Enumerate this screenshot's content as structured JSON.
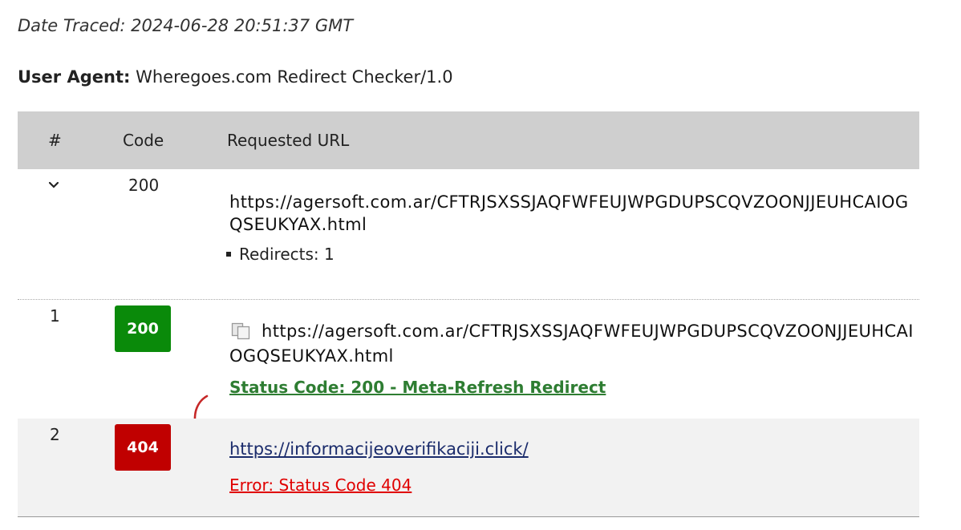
{
  "date_traced": "Date Traced: 2024-06-28 20:51:37 GMT",
  "user_agent": {
    "label": "User Agent:",
    "value": "Wheregoes.com Redirect Checker/1.0"
  },
  "table": {
    "headers": {
      "num": "#",
      "code": "Code",
      "url": "Requested URL"
    }
  },
  "summary": {
    "chevron": "⌄",
    "code": "200",
    "url": "https://agersoft.com.ar/CFTRJSXSSJAQFWFEUJWPGDUPSCQVZOONJJEUHCAIOGQSEUKYAX.html",
    "redirects": "Redirects: 1"
  },
  "rows": [
    {
      "index": "1",
      "code": "200",
      "url": "https://agersoft.com.ar/CFTRJSXSSJAQFWFEUJWPGDUPSCQVZOONJJEUHCAIOGQSEUKYAX.html",
      "status": "Status Code: 200 - Meta-Refresh Redirect",
      "badge_color": "#0a8a0a"
    },
    {
      "index": "2",
      "code": "404",
      "url": "https://informacijeoverifikaciji.click/",
      "status": "Error: Status Code 404",
      "badge_color": "#c00000"
    }
  ],
  "icons": {
    "copy": "copy-icon",
    "chevron": "chevron-down-icon",
    "redirect_arrow": "redirect-arrow-icon"
  }
}
